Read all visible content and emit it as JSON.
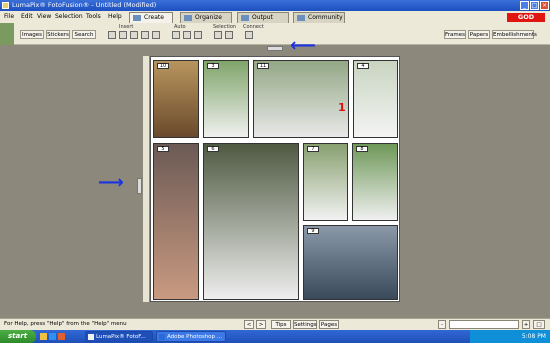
{
  "window": {
    "title": "LumaPix® FotoFusion® - Untitled (Modified)",
    "controls": [
      "_",
      "□",
      "×"
    ]
  },
  "menu": [
    "File",
    "Edit",
    "View",
    "Selection",
    "Tools",
    "Help"
  ],
  "tabs": [
    {
      "label": "Create",
      "active": true
    },
    {
      "label": "Organize",
      "active": false
    },
    {
      "label": "Output",
      "active": false
    },
    {
      "label": "Community",
      "active": false
    }
  ],
  "badge": "GOD",
  "toolbar": {
    "left_buttons": [
      "Images",
      "Stickers",
      "Search"
    ],
    "groups": [
      "Insert",
      "Auto",
      "Selection",
      "Connect"
    ],
    "right_buttons": [
      "Frames",
      "Papers",
      "Embellishments"
    ]
  },
  "collage": {
    "photos": [
      {
        "number": "10",
        "color_top": "#b8955e",
        "color_bottom": "#6a4a2c"
      },
      {
        "number": "3",
        "color_top": "#7fa46a",
        "color_bottom": "#f0f0f0"
      },
      {
        "number": "11",
        "color_top": "#93a785",
        "color_bottom": "#e8e8e8",
        "overlay": "1"
      },
      {
        "number": "4",
        "color_top": "#c8d4c0",
        "color_bottom": "#f4f4f4"
      },
      {
        "number": "5",
        "color_top": "#6b5a55",
        "color_bottom": "#c99a80"
      },
      {
        "number": "6",
        "color_top": "#4f5a42",
        "color_bottom": "#eeeeee"
      },
      {
        "number": "7",
        "color_top": "#88a070",
        "color_bottom": "#f2f2f2"
      },
      {
        "number": "8",
        "color_top": "#6e9858",
        "color_bottom": "#f0f0f0"
      },
      {
        "number": "9",
        "color_top": "#8a98a8",
        "color_bottom": "#3a4a5a"
      }
    ]
  },
  "statusbar": {
    "help_text": "For Help, press \"Help\" from the \"Help\" menu",
    "buttons": [
      "Tips",
      "Settings",
      "Pages"
    ]
  },
  "taskbar": {
    "start_label": "start",
    "tasks": [
      {
        "label": "LumaPix® FotoF...",
        "active": true
      },
      {
        "label": "Adobe Photoshop ...",
        "active": false
      }
    ],
    "clock": "5:08 PM"
  },
  "colors": {
    "accent": "#1a33e0",
    "badge": "#e0150f",
    "canvas_bg": "#8c887b"
  }
}
